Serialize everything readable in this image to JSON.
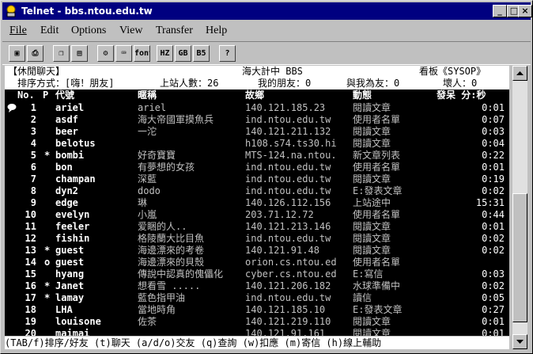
{
  "window": {
    "title": "Telnet - bbs.ntou.edu.tw",
    "controls": {
      "minimize": "_",
      "maximize": "□",
      "close": "×"
    }
  },
  "menu": [
    "File",
    "Edit",
    "Options",
    "View",
    "Transfer",
    "Help"
  ],
  "toolbar": [
    "copy-screen",
    "print",
    "copy",
    "paste",
    "settings",
    "keyboard",
    "font",
    "HZ",
    "GB",
    "B5",
    "?"
  ],
  "terminal": {
    "header1": {
      "left": "【休閒聊天】",
      "center": "海大計中 BBS",
      "right": "看板《SYSOP》"
    },
    "header2": {
      "sort": "排序方式：[嗨！朋友]",
      "online": "上站人數：26",
      "friends": "我的朋友：0",
      "fans": "與我為友：0",
      "hidden": "壞人：0"
    },
    "columns": {
      "no": "No.",
      "p": "P",
      "id": "代號",
      "nick": "暱稱",
      "from": "故鄉",
      "action": "動態",
      "idle": "發呆 分:秒"
    },
    "rows": [
      {
        "no": "1",
        "p": "",
        "id": "ariel",
        "nick": "ariel",
        "from": "140.121.185.23",
        "action": "閱讀文章",
        "idle": "0:01"
      },
      {
        "no": "2",
        "p": "",
        "id": "asdf",
        "nick": "海大帝國軍摸魚兵",
        "from": "ind.ntou.edu.tw",
        "action": "使用者名單",
        "idle": "0:07"
      },
      {
        "no": "3",
        "p": "",
        "id": "beer",
        "nick": "一沱",
        "from": "140.121.211.132",
        "action": "閱讀文章",
        "idle": "0:03"
      },
      {
        "no": "4",
        "p": "",
        "id": "belotus",
        "nick": "",
        "from": "h108.s74.ts30.hi",
        "action": "閱讀文章",
        "idle": "0:04"
      },
      {
        "no": "5",
        "p": "*",
        "id": "bombi",
        "nick": "好奇寶寶",
        "from": "MTS-124.na.ntou.",
        "action": "新文章列表",
        "idle": "0:22"
      },
      {
        "no": "6",
        "p": "",
        "id": "bon",
        "nick": "有夢想的女孩",
        "from": "ind.ntou.edu.tw",
        "action": "使用者名單",
        "idle": "0:01"
      },
      {
        "no": "7",
        "p": "",
        "id": "champan",
        "nick": "深藍",
        "from": "ind.ntou.edu.tw",
        "action": "閱讀文章",
        "idle": "0:19"
      },
      {
        "no": "8",
        "p": "",
        "id": "dyn2",
        "nick": "dodo",
        "from": "ind.ntou.edu.tw",
        "action": "E:發表文章",
        "idle": "0:02"
      },
      {
        "no": "9",
        "p": "",
        "id": "edge",
        "nick": "琳",
        "from": "140.126.112.156",
        "action": "上站途中",
        "idle": "15:31"
      },
      {
        "no": "10",
        "p": "",
        "id": "evelyn",
        "nick": "小嵐",
        "from": "203.71.12.72",
        "action": "使用者名單",
        "idle": "0:44"
      },
      {
        "no": "11",
        "p": "",
        "id": "feeler",
        "nick": "爱睏的人..",
        "from": "140.121.213.146",
        "action": "閱讀文章",
        "idle": "0:01"
      },
      {
        "no": "12",
        "p": "",
        "id": "fishin",
        "nick": "格陵蘭大比目魚",
        "from": "ind.ntou.edu.tw",
        "action": "閱讀文章",
        "idle": "0:02"
      },
      {
        "no": "13",
        "p": "*",
        "id": "guest",
        "nick": "海邊漂來的考卷",
        "from": "140.121.91.48",
        "action": "閱讀文章",
        "idle": "0:02"
      },
      {
        "no": "14",
        "p": "o",
        "id": "guest",
        "nick": "海邊漂來的貝殼",
        "from": "orion.cs.ntou.ed",
        "action": "使用者名單",
        "idle": ""
      },
      {
        "no": "15",
        "p": "",
        "id": "hyang",
        "nick": "傳說中認真的傀儡化",
        "from": "cyber.cs.ntou.ed",
        "action": "E:寫信",
        "idle": "0:03"
      },
      {
        "no": "16",
        "p": "*",
        "id": "Janet",
        "nick": "想看雪 .....",
        "from": "140.121.206.182",
        "action": "水球準備中",
        "idle": "0:02"
      },
      {
        "no": "17",
        "p": "*",
        "id": "lamay",
        "nick": "藍色指甲油",
        "from": "ind.ntou.edu.tw",
        "action": "讀信",
        "idle": "0:05"
      },
      {
        "no": "18",
        "p": "",
        "id": "LHA",
        "nick": "當地時角",
        "from": "140.121.185.10",
        "action": "E:發表文章",
        "idle": "0:27"
      },
      {
        "no": "19",
        "p": "",
        "id": "louisone",
        "nick": "佐茶",
        "from": "140.121.219.110",
        "action": "閱讀文章",
        "idle": "0:01"
      },
      {
        "no": "20",
        "p": "",
        "id": "maimai",
        "nick": "",
        "from": "140.121.91.161",
        "action": "閱讀文章",
        "idle": "0:01"
      }
    ],
    "footer": "(TAB/f)排序/好友 (t)聊天 (a/d/o)交友 (q)查詢 (w)扣應 (m)寄信 (h)線上輔助"
  }
}
